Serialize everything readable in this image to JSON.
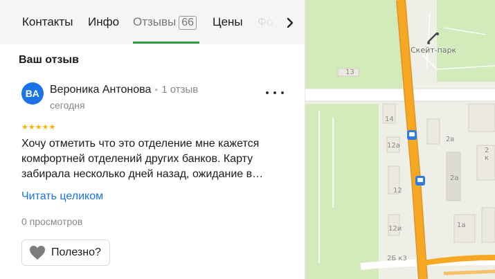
{
  "tabs": [
    {
      "label": "Контакты"
    },
    {
      "label": "Инфо"
    },
    {
      "label": "Отзывы",
      "count": "66",
      "active": true
    },
    {
      "label": "Цены"
    },
    {
      "label": "Фо"
    }
  ],
  "review": {
    "section_title": "Ваш отзыв",
    "avatar_initials": "ВА",
    "author": "Вероника Антонова",
    "author_reviews": "1 отзыв",
    "date": "сегодня",
    "rating": 5,
    "stars": "★★★★★",
    "text_lines": [
      "Хочу отметить что это отделение мне кажется",
      "комфортней отделений других банков. Карту",
      "забирала несколько дней назад, ожидание в…"
    ],
    "read_more": "Читать целиком",
    "views": "0 просмотров",
    "useful_label": "Полезно?"
  },
  "map": {
    "park_label": "Скейт-парк",
    "house_labels": [
      "13",
      "14",
      "12а",
      "12",
      "12и",
      "2в",
      "2 к",
      "2а",
      "1а",
      "2Б к3"
    ]
  },
  "colors": {
    "accent_green": "#2d9b3a",
    "link_blue": "#1a73e8",
    "star": "#f6b600",
    "road": "#f7a823",
    "park": "#d3ebbb"
  }
}
